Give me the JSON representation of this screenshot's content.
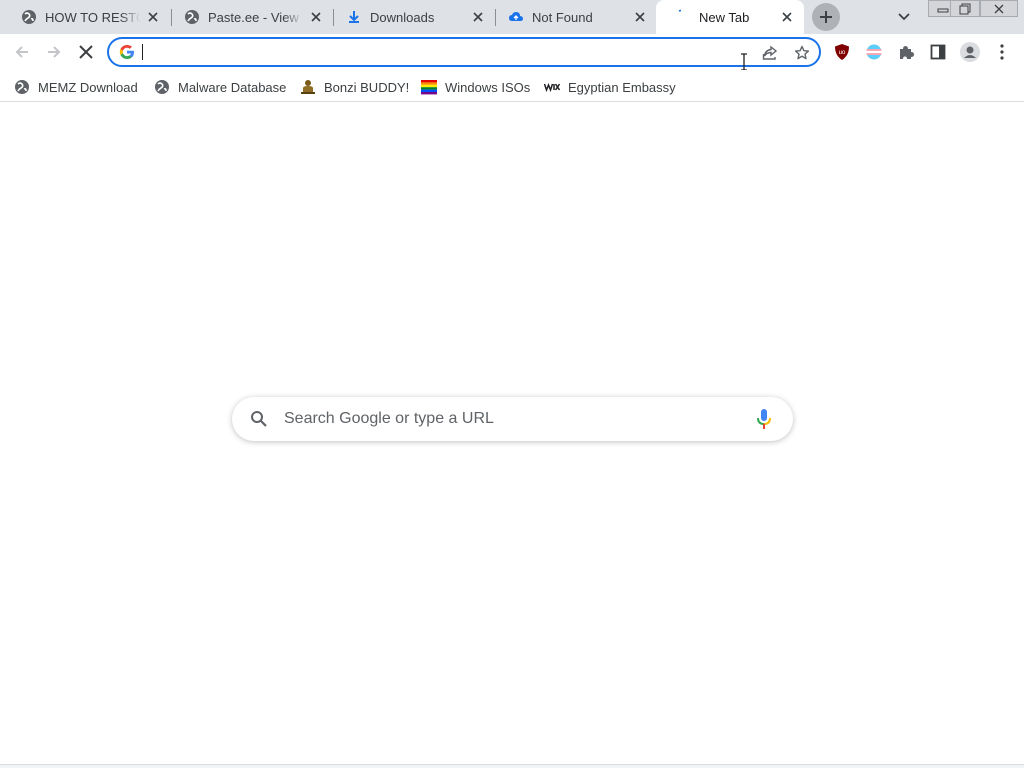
{
  "tabs": [
    {
      "title": "HOW TO RESTORE",
      "icon": "globe-icon"
    },
    {
      "title": "Paste.ee - View paste",
      "icon": "globe-icon"
    },
    {
      "title": "Downloads",
      "icon": "download-icon"
    },
    {
      "title": "Not Found",
      "icon": "cloud-upload-icon"
    },
    {
      "title": "New Tab",
      "icon": "loading-spinner-icon",
      "active": true
    }
  ],
  "new_tab_label": "+",
  "omnibox": {
    "value": "",
    "placeholder": ""
  },
  "bookmarks": [
    {
      "label": "MEMZ Download",
      "icon": "globe-icon"
    },
    {
      "label": "Malware Database",
      "icon": "globe-icon"
    },
    {
      "label": "Bonzi BUDDY!",
      "icon": "bonzi-icon"
    },
    {
      "label": "Windows ISOs",
      "icon": "rainbow-flag-icon"
    },
    {
      "label": "Egyptian Embassy",
      "icon": "wix-icon"
    }
  ],
  "ntp": {
    "search_placeholder": "Search Google or type a URL"
  },
  "colors": {
    "accent": "#1a73e8",
    "tabstrip": "#dee1e6",
    "ublock": "#800000"
  }
}
